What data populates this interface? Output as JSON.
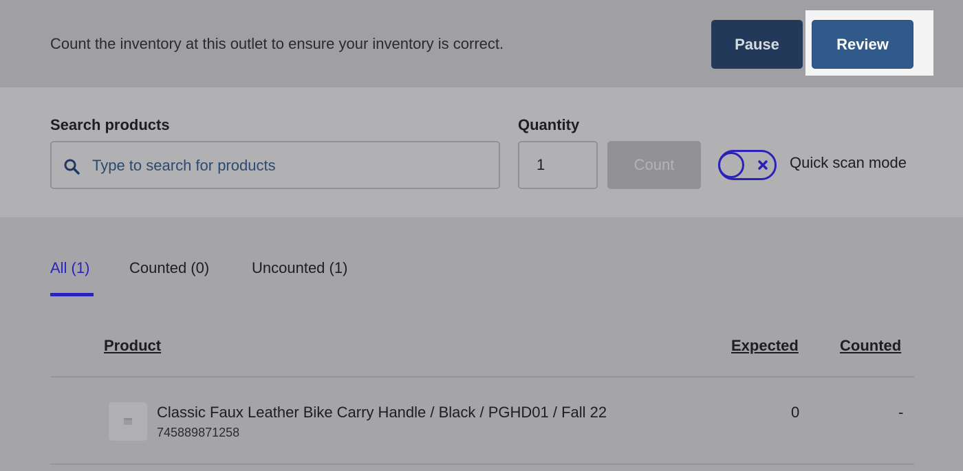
{
  "header": {
    "instruction": "Count the inventory at this outlet to ensure your inventory is correct.",
    "pause_label": "Pause",
    "review_label": "Review"
  },
  "search": {
    "label": "Search products",
    "placeholder": "Type to search for products",
    "icon": "search-icon"
  },
  "quantity": {
    "label": "Quantity",
    "value": "1"
  },
  "count_button": "Count",
  "quick_scan": {
    "label": "Quick scan mode",
    "enabled": false
  },
  "tabs": [
    {
      "label": "All (1)",
      "active": true
    },
    {
      "label": "Counted (0)",
      "active": false
    },
    {
      "label": "Uncounted (1)",
      "active": false
    }
  ],
  "table": {
    "columns": {
      "product": "Product",
      "expected": "Expected",
      "counted": "Counted"
    },
    "rows": [
      {
        "name": "Classic Faux Leather Bike Carry Handle / Black / PGHD01 / Fall 22",
        "sku": "745889871258",
        "expected": "0",
        "counted": "-"
      }
    ]
  },
  "colors": {
    "accent": "#2c22c0",
    "pause_bg": "#22395a",
    "review_bg": "#2f5a8a"
  }
}
